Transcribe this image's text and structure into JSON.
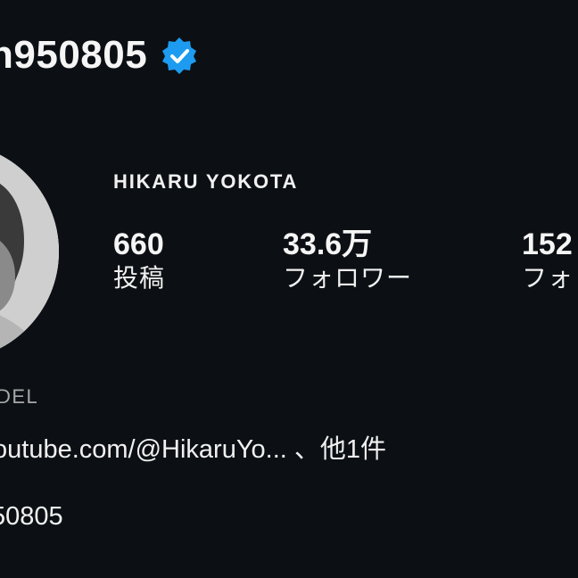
{
  "profile": {
    "username": "n950805",
    "verified_badge_color": "#1d9bf0",
    "display_name": "HIKARU YOKOTA",
    "category": "DEL",
    "links_text": "outube.com/@HikaruYo... 、他1件",
    "handle_text": "50805"
  },
  "stats": {
    "posts_value": "660",
    "posts_label": "投稿",
    "followers_value": "33.6万",
    "followers_label": "フォロワー",
    "following_value": "152",
    "following_label": "フォ"
  },
  "icons": {
    "verified": "verified-badge-icon",
    "avatar": "profile-photo"
  },
  "colors": {
    "background": "#0c1014",
    "text": "#f5f5f5",
    "muted": "#a8a8a8",
    "accent": "#1d9bf0"
  }
}
